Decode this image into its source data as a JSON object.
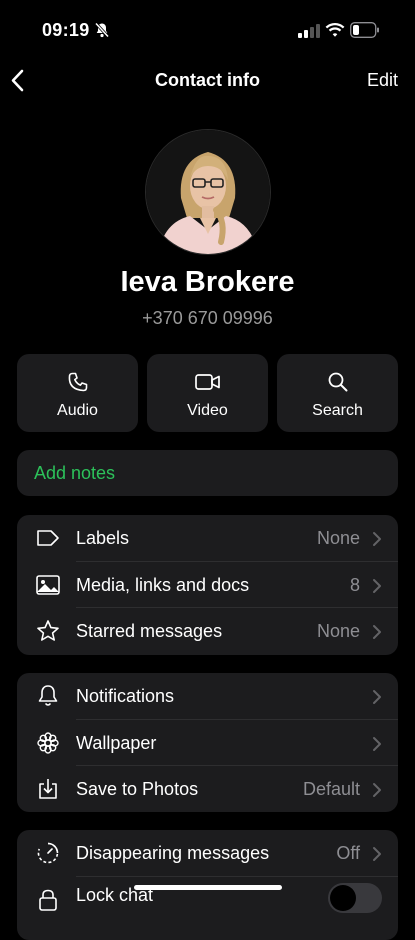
{
  "status": {
    "time": "09:19"
  },
  "nav": {
    "title": "Contact info",
    "edit_label": "Edit"
  },
  "contact": {
    "name": "Ieva Brokere",
    "phone": "+370 670 09996"
  },
  "actions": [
    {
      "label": "Audio",
      "icon": "phone-icon"
    },
    {
      "label": "Video",
      "icon": "video-icon"
    },
    {
      "label": "Search",
      "icon": "search-icon"
    }
  ],
  "notes": {
    "label": "Add notes"
  },
  "group1": [
    {
      "label": "Labels",
      "value": "None",
      "icon": "label-icon"
    },
    {
      "label": "Media, links and docs",
      "value": "8",
      "icon": "image-icon"
    },
    {
      "label": "Starred messages",
      "value": "None",
      "icon": "star-icon"
    }
  ],
  "group2": [
    {
      "label": "Notifications",
      "value": "",
      "icon": "bell-icon"
    },
    {
      "label": "Wallpaper",
      "value": "",
      "icon": "flower-icon"
    },
    {
      "label": "Save to Photos",
      "value": "Default",
      "icon": "download-icon"
    }
  ],
  "group3": [
    {
      "label": "Disappearing messages",
      "value": "Off",
      "icon": "timer-icon"
    },
    {
      "label": "Lock chat",
      "value": "",
      "icon": "lock-icon",
      "toggle_on": false
    }
  ],
  "colors": {
    "accent_green": "#2cc15a",
    "card": "#1c1c1e",
    "secondary_text": "#8e8e93"
  }
}
